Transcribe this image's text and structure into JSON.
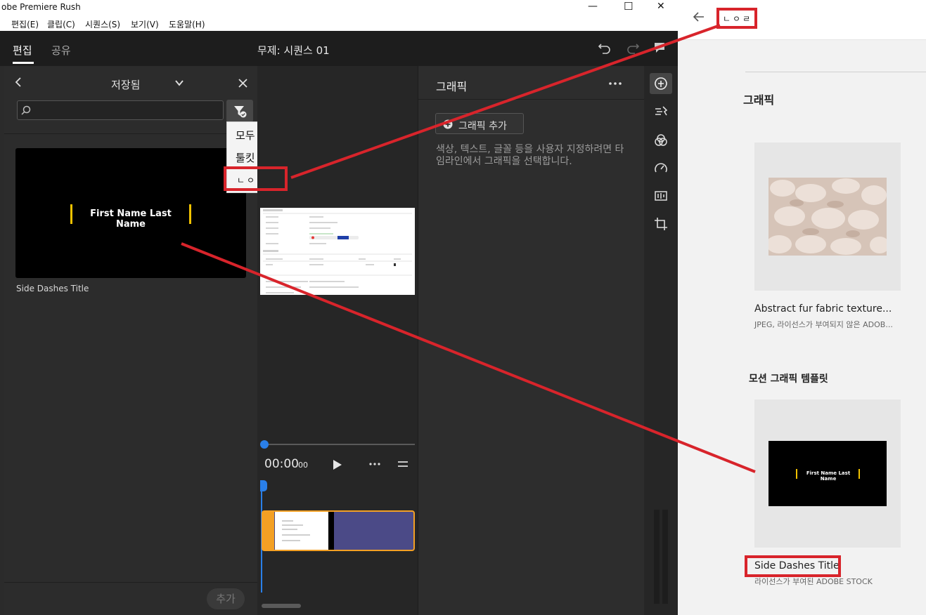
{
  "app": {
    "window_title": "obe Premiere Rush",
    "window_controls": {
      "minimize": "—",
      "maximize": "☐",
      "close": "✕"
    },
    "menu": [
      "편집(E)",
      "클립(C)",
      "시퀀스(S)",
      "보기(V)",
      "도움말(H)"
    ],
    "header": {
      "tabs": [
        "편집",
        "공유"
      ],
      "sequence_title": "무제: 시퀀스 01"
    }
  },
  "saved_panel": {
    "title": "저장됨",
    "search_placeholder": "",
    "filter_menu": [
      "모두",
      "툴킷",
      "ㄴㅇㄹ"
    ],
    "card": {
      "preview_text": "First Name Last Name",
      "title": "Side Dashes Title"
    },
    "add_button": "추가"
  },
  "timeline": {
    "time_main": "00:00",
    "time_frames": "00"
  },
  "graphics_panel": {
    "title": "그래픽",
    "add_button": "그래픽 추가",
    "help_text": "색상, 텍스트, 글꼴 등을 사용자 지정하려면 타임라인에서 그래픽을 선택합니다."
  },
  "right_pane": {
    "header_label": "ㄴㅇㄹ",
    "section_graphics": "그래픽",
    "stock_item": {
      "title": "Abstract fur fabric texture...",
      "subtitle": "JPEG, 라이선스가 부여되지 않은 ADOB..."
    },
    "section_mogrt": "모션 그래픽 템플릿",
    "mogrt_item": {
      "preview_text": "First Name Last Name",
      "title": "Side Dashes Title",
      "subtitle": "라이선스가 부여된 ADOBE STOCK"
    }
  },
  "colors": {
    "accent_blue": "#2a7fe8",
    "annotation_red": "#d8242b",
    "title_dash_yellow": "#f2c200",
    "clip_orange": "#f3a024",
    "clip_purple": "#4b4a87"
  }
}
